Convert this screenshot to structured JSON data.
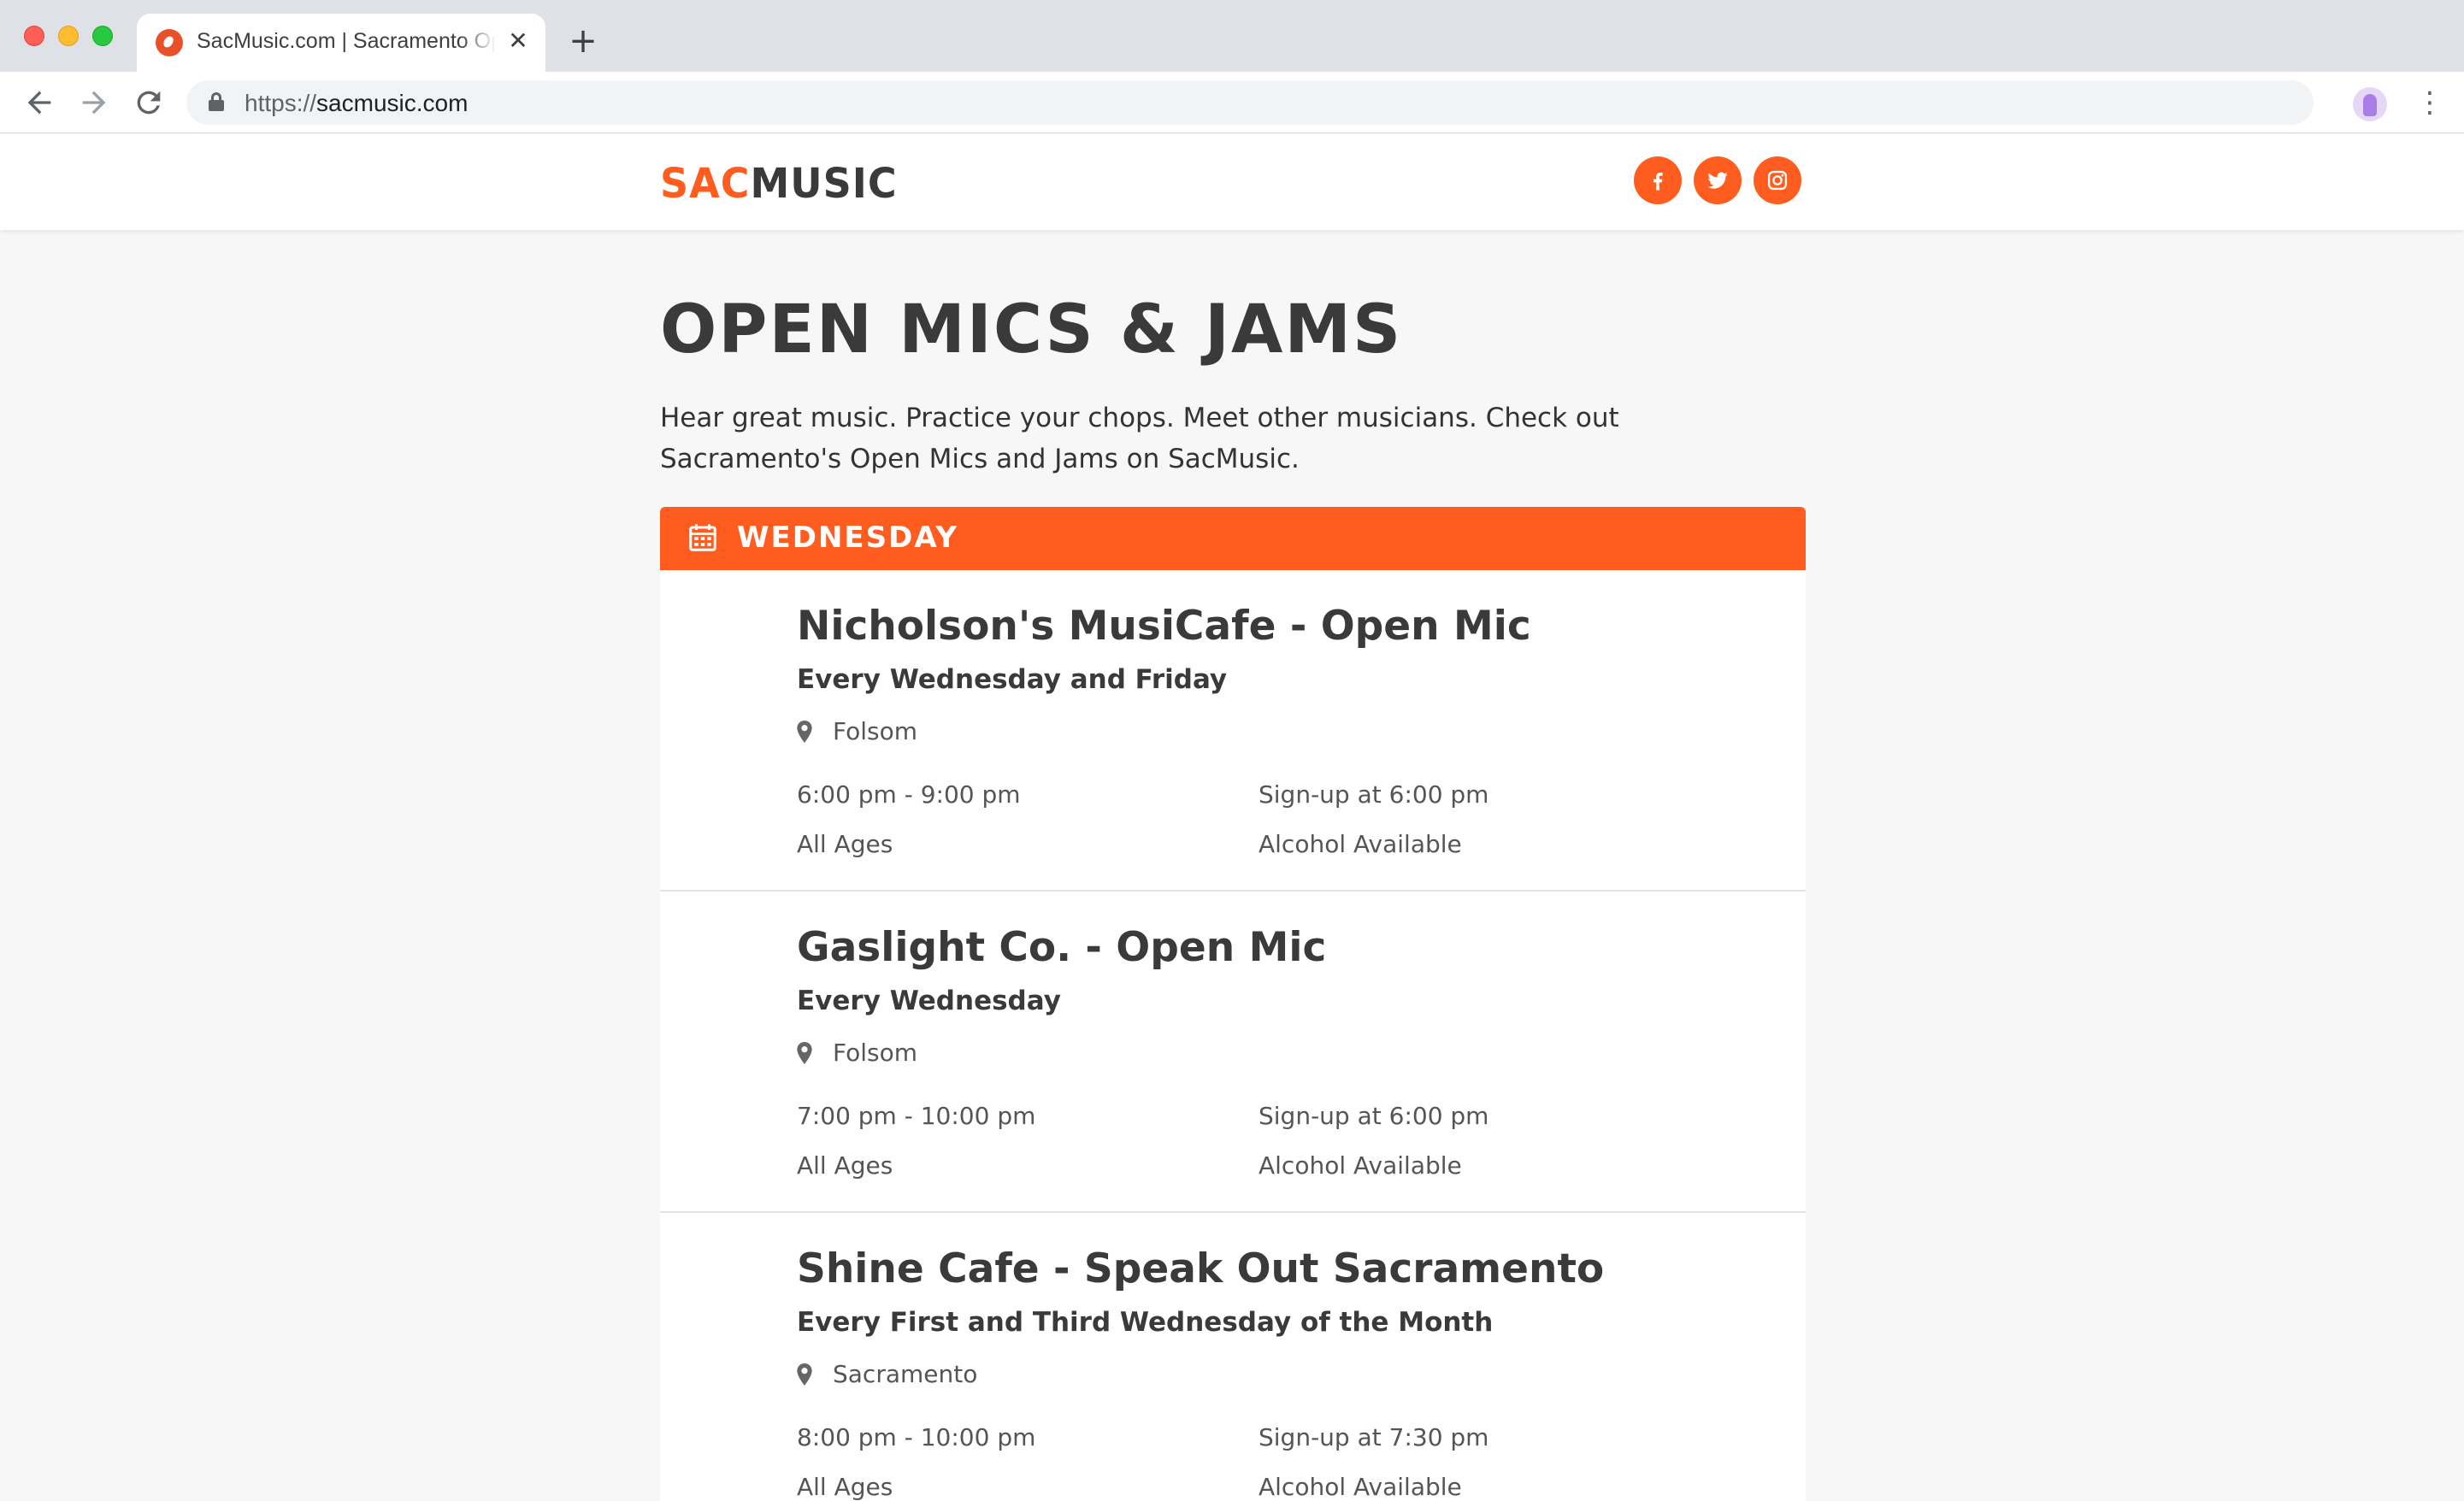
{
  "browser": {
    "tab_title": "SacMusic.com | Sacramento Open Mics & Jams",
    "tab_close": "✕",
    "new_tab": "+",
    "url_scheme": "https://",
    "url_host": "sacmusic.com",
    "icons": [
      "back-arrow-icon",
      "forward-arrow-icon",
      "reload-icon",
      "lock-icon",
      "star-icon",
      "avatar",
      "menu-kebab-icon"
    ]
  },
  "site": {
    "logo_sac": "SAC",
    "logo_music": "MUSIC",
    "brand_color": "#ff5c1f",
    "text_color": "#3a3a3a",
    "social": [
      "facebook-icon",
      "twitter-icon",
      "instagram-icon"
    ]
  },
  "page": {
    "title": "OPEN MICS & JAMS",
    "intro": "Hear great music. Practice your chops. Meet other musicians. Check out Sacramento's Open Mics and Jams on SacMusic."
  },
  "day": {
    "label": "WEDNESDAY",
    "icon": "calendar-icon"
  },
  "events": [
    {
      "name": "Nicholson's MusiCafe - Open Mic",
      "schedule": "Every Wednesday and Friday",
      "city": "Folsom",
      "time": "6:00 pm - 9:00 pm",
      "signup": "Sign-up at 6:00 pm",
      "ages": "All Ages",
      "alcohol": "Alcohol Available"
    },
    {
      "name": "Gaslight Co. - Open Mic",
      "schedule": "Every Wednesday",
      "city": "Folsom",
      "time": "7:00 pm - 10:00 pm",
      "signup": "Sign-up at 6:00 pm",
      "ages": "All Ages",
      "alcohol": "Alcohol Available"
    },
    {
      "name": "Shine Cafe - Speak Out Sacramento",
      "schedule": "Every First and Third Wednesday of the Month",
      "city": "Sacramento",
      "time": "8:00 pm - 10:00 pm",
      "signup": "Sign-up at 7:30 pm",
      "ages": "All Ages",
      "alcohol": "Alcohol Available"
    }
  ]
}
